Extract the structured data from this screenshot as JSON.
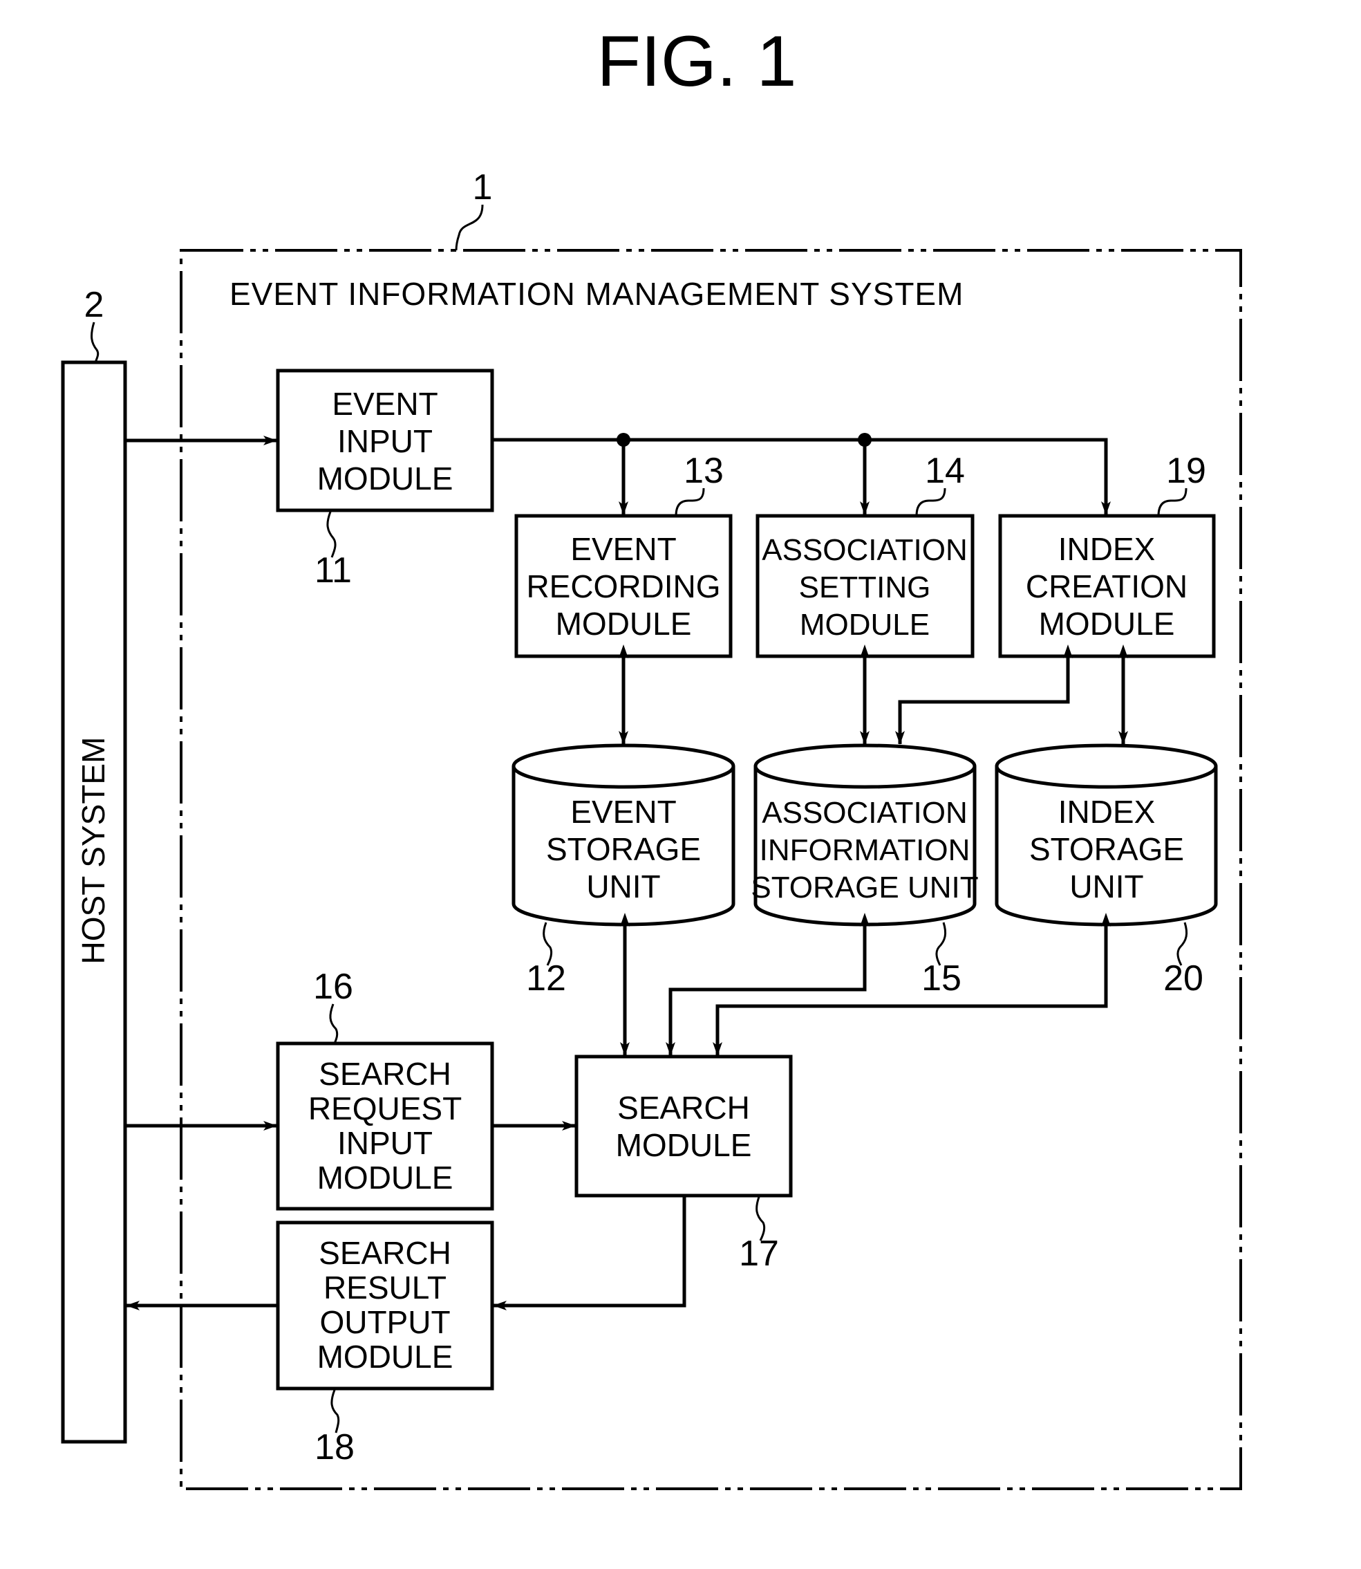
{
  "figure": {
    "title": "FIG. 1"
  },
  "system": {
    "ref": "1",
    "title": "EVENT INFORMATION MANAGEMENT SYSTEM"
  },
  "host": {
    "ref": "2",
    "label": "HOST SYSTEM"
  },
  "modules": {
    "event_input": {
      "ref": "11",
      "lines": [
        "EVENT",
        "INPUT",
        "MODULE"
      ]
    },
    "event_recording": {
      "ref": "13",
      "lines": [
        "EVENT",
        "RECORDING",
        "MODULE"
      ]
    },
    "association_setting": {
      "ref": "14",
      "lines": [
        "ASSOCIATION",
        "SETTING",
        "MODULE"
      ]
    },
    "index_creation": {
      "ref": "19",
      "lines": [
        "INDEX",
        "CREATION",
        "MODULE"
      ]
    },
    "search_request_input": {
      "ref": "16",
      "lines": [
        "SEARCH",
        "REQUEST",
        "INPUT",
        "MODULE"
      ]
    },
    "search": {
      "ref": "17",
      "lines": [
        "SEARCH",
        "MODULE"
      ]
    },
    "search_result_output": {
      "ref": "18",
      "lines": [
        "SEARCH",
        "RESULT",
        "OUTPUT",
        "MODULE"
      ]
    }
  },
  "storage": {
    "event_storage": {
      "ref": "12",
      "lines": [
        "EVENT",
        "STORAGE",
        "UNIT"
      ]
    },
    "association_storage": {
      "ref": "15",
      "lines": [
        "ASSOCIATION",
        "INFORMATION",
        "STORAGE UNIT"
      ]
    },
    "index_storage": {
      "ref": "20",
      "lines": [
        "INDEX",
        "STORAGE",
        "UNIT"
      ]
    }
  },
  "icons": {
    "arrowhead": "arrowhead-icon",
    "junction": "junction-dot-icon",
    "database": "cylinder-database-icon"
  }
}
